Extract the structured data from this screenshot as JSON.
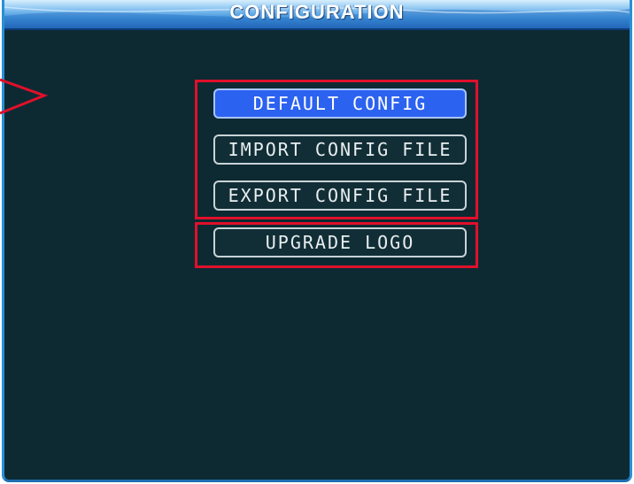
{
  "window": {
    "title": "CONFIGURATION"
  },
  "menu": {
    "items": [
      {
        "label": "DEFAULT CONFIG",
        "selected": true
      },
      {
        "label": "IMPORT CONFIG FILE",
        "selected": false
      },
      {
        "label": "EXPORT CONFIG FILE",
        "selected": false
      },
      {
        "label": "UPGRADE LOGO",
        "selected": false
      }
    ]
  },
  "colors": {
    "background": "#0d2a33",
    "titlebar": "#3f93db",
    "selected_button": "#2c62f0",
    "highlight": "#e0102a",
    "pointer": "#e0102a"
  },
  "icons": {
    "pointer": "arrow-pointer-icon"
  }
}
